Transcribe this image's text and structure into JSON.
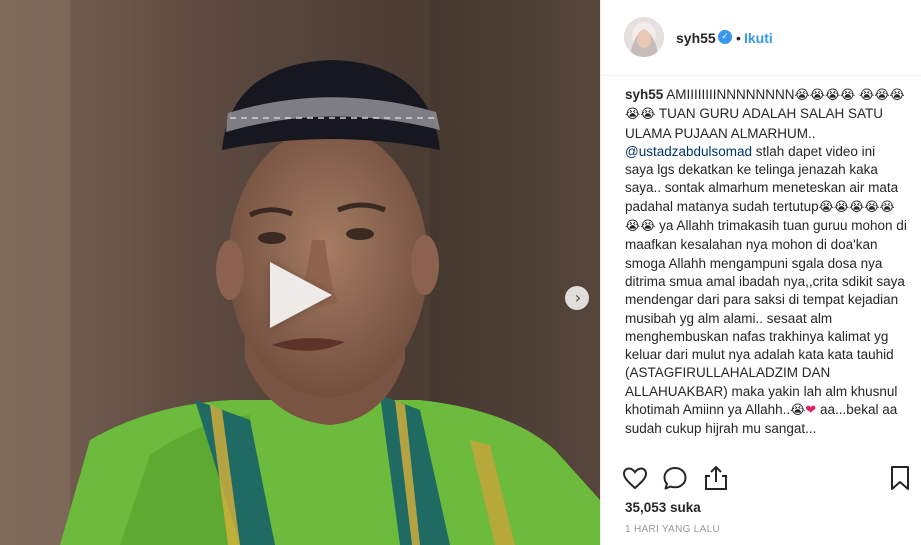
{
  "post": {
    "username": "syh55",
    "verified_icon": "verified-badge-icon",
    "separator": "•",
    "follow_label": "Ikuti",
    "caption_username": "syh55",
    "caption_part1": "AMIIIIIIIINNNNNNNN",
    "caption_part1b": "TUAN GURU ADALAH SALAH SATU ULAMA PUJAAN ALMARHUM..",
    "mention": "@ustadzabdulsomad",
    "caption_part2": "stlah dapet video ini saya lgs dekatkan ke telinga jenazah kaka saya.. sontak almarhum meneteskan air mata padahal matanya sudah tertutup",
    "caption_part3": "ya Allahh trimakasih tuan guruu mohon di maafkan kesalahan nya mohon di doa'kan smoga Allahh mengampuni sgala dosa nya ditrima smua amal ibadah nya,,crita sdikit saya mendengar dari para saksi di tempat kejadian musibah yg alm alami.. sesaat alm menghembuskan nafas trakhinya kalimat yg keluar dari mulut nya adalah kata kata tauhid (ASTAGFIRULLAHALADZIM DAN ALLAHUAKBAR) maka yakin lah alm khusnul khotimah Amiinn ya Allahh..",
    "caption_part4": "aa...bekal aa sudah cukup hijrah mu",
    "caption_part5": "sangat... ",
    "emoji_cry": "😭",
    "emoji_heart": "❤",
    "likes": "35,053 suka",
    "timestamp": "1 HARI YANG LALU"
  },
  "media": {
    "type": "video",
    "play_icon": "play-icon",
    "next_icon": "chevron-right-icon"
  },
  "actions": {
    "like_icon": "heart-icon",
    "comment_icon": "comment-icon",
    "share_icon": "share-icon",
    "save_icon": "bookmark-icon"
  },
  "colors": {
    "link": "#3897f0",
    "mention": "#003569",
    "text": "#262626",
    "muted": "#999999"
  }
}
